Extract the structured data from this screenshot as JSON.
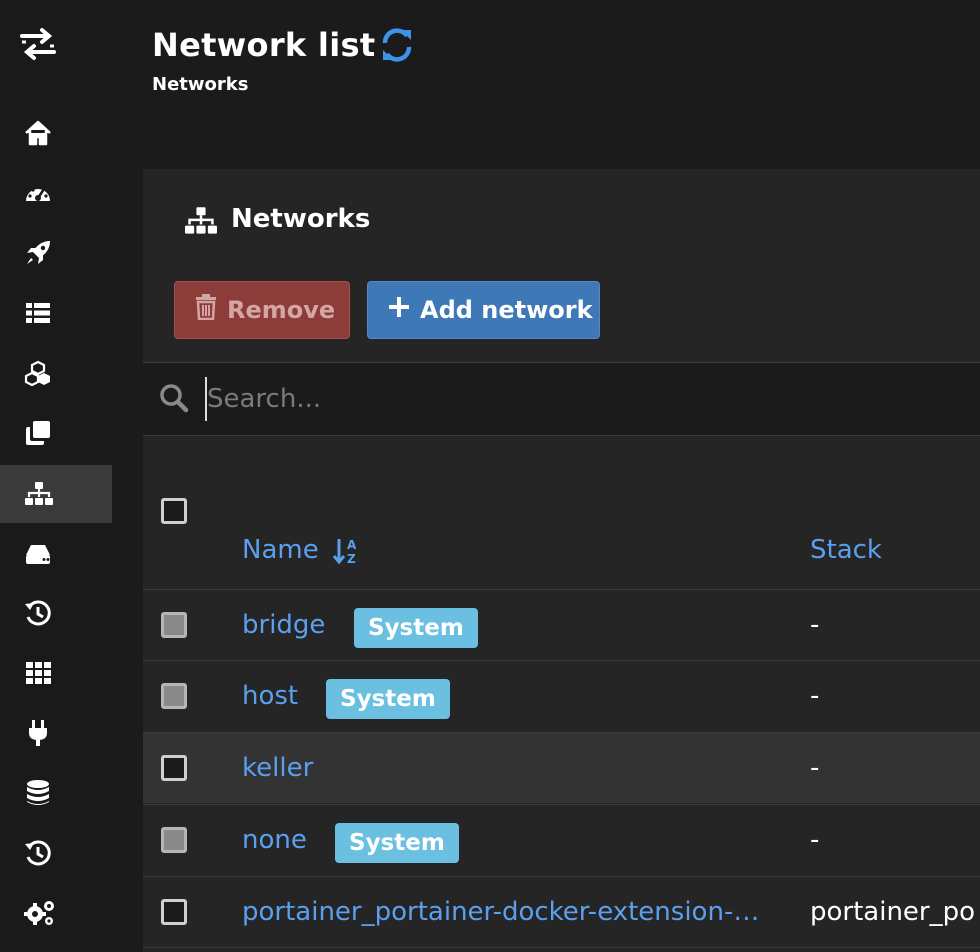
{
  "header": {
    "title": "Network list",
    "subtitle": "Networks"
  },
  "panel": {
    "title": "Networks"
  },
  "toolbar": {
    "remove_label": "Remove",
    "add_label": "Add network"
  },
  "search": {
    "placeholder": "Search..."
  },
  "table": {
    "columns": [
      "Name",
      "Stack"
    ],
    "rows": [
      {
        "name": "bridge",
        "badge": "System",
        "stack": "-"
      },
      {
        "name": "host",
        "badge": "System",
        "stack": "-"
      },
      {
        "name": "keller",
        "badge": "",
        "stack": "-"
      },
      {
        "name": "none",
        "badge": "System",
        "stack": "-"
      },
      {
        "name": "portainer_portainer-docker-extension-…",
        "badge": "",
        "stack": "portainer_po"
      }
    ]
  },
  "sidebar": {
    "icons": [
      "logo-icon",
      "home-icon",
      "dashboard-icon",
      "rocket-icon",
      "list-icon",
      "cubes-icon",
      "clone-icon",
      "sitemap-icon",
      "hdd-icon",
      "history-icon",
      "grid-icon",
      "plug-icon",
      "database-icon",
      "history-icon",
      "settings-icon"
    ],
    "active": "sitemap-icon"
  },
  "colors": {
    "accent": "#5aa0ee",
    "badge": "#6bbfe0",
    "danger": "#8d3d39",
    "primary": "#3e78b7"
  }
}
